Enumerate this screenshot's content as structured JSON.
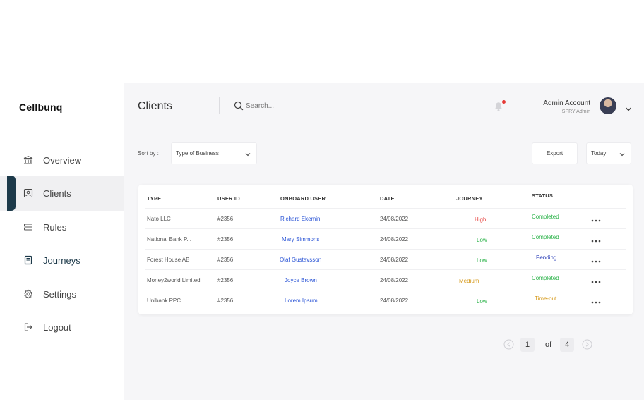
{
  "brand": {
    "logo": "Cellbunq"
  },
  "sidebar": {
    "items": [
      {
        "label": "Overview"
      },
      {
        "label": "Clients"
      },
      {
        "label": "Rules"
      },
      {
        "label": "Journeys"
      },
      {
        "label": "Settings"
      },
      {
        "label": "Logout"
      }
    ]
  },
  "header": {
    "title": "Clients",
    "search_placeholder": "Search...",
    "account_name": "Admin Account",
    "account_role": "SPRY Admin"
  },
  "toolbar": {
    "sort_label": "Sort by :",
    "sort_value": "Type of Business",
    "export_label": "Export",
    "range_value": "Today"
  },
  "table": {
    "headers": [
      "TYPE",
      "USER ID",
      "ONBOARD USER",
      "DATE",
      "JOURNEY",
      "STATUS"
    ],
    "rows": [
      {
        "type": "Nato LLC",
        "id": "#2356",
        "user": "Richard Ekemini",
        "date": "24/08/2022",
        "journey": "High",
        "status": "Completed"
      },
      {
        "type": "National Bank  P...",
        "id": "#2356",
        "user": "Mary Simmons",
        "date": "24/08/2022",
        "journey": "Low",
        "status": "Completed"
      },
      {
        "type": "Forest House AB",
        "id": "#2356",
        "user": "Olaf Gustavsson",
        "date": "24/08/2022",
        "journey": "Low",
        "status": "Pending"
      },
      {
        "type": "Money2world Limited",
        "id": "#2356",
        "user": "Joyce Brown",
        "date": "24/08/2022",
        "journey": "Medium",
        "status": "Completed"
      },
      {
        "type": "Unibank PPC",
        "id": "#2356",
        "user": "Lorem Ipsum",
        "date": "24/08/2022",
        "journey": "Low",
        "status": "Time-out"
      }
    ]
  },
  "pagination": {
    "current": "1",
    "of_label": "of",
    "total": "4"
  },
  "colors": {
    "accent": "#1d3a4a",
    "link": "#2b55d6",
    "high": "#e53935",
    "low": "#2cb34a",
    "medium": "#d69a1c",
    "pending": "#2b3fb8",
    "timeout": "#d69a1c"
  },
  "icons": [
    "bank-icon",
    "id-card-icon",
    "rules-icon",
    "journal-icon",
    "gear-icon",
    "logout-icon",
    "search-icon",
    "bell-icon",
    "chevron-down-icon",
    "more-icon",
    "chevron-left-icon",
    "chevron-right-icon"
  ]
}
